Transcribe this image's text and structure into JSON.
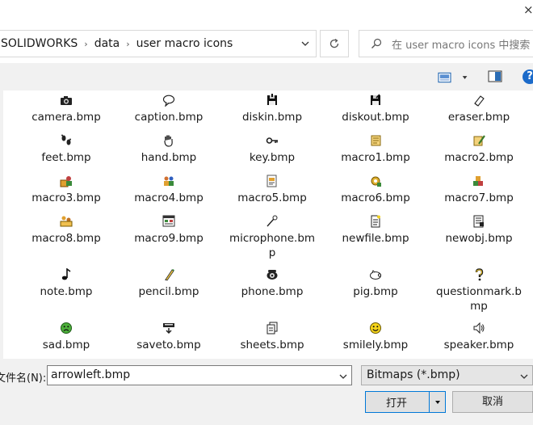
{
  "window": {
    "close_glyph": "×"
  },
  "address": {
    "crumbs": [
      "SOLIDWORKS",
      "data",
      "user macro icons"
    ],
    "separator": "›"
  },
  "search": {
    "placeholder": "在 user macro icons 中搜索"
  },
  "files": [
    {
      "name": "camera.bmp",
      "icon": "camera-icon"
    },
    {
      "name": "caption.bmp",
      "icon": "speech-bubble-icon"
    },
    {
      "name": "diskin.bmp",
      "icon": "floppy-disk-in-icon"
    },
    {
      "name": "diskout.bmp",
      "icon": "floppy-disk-out-icon"
    },
    {
      "name": "eraser.bmp",
      "icon": "eraser-icon"
    },
    {
      "name": "feet.bmp",
      "icon": "footprints-icon"
    },
    {
      "name": "hand.bmp",
      "icon": "hand-icon"
    },
    {
      "name": "key.bmp",
      "icon": "key-icon"
    },
    {
      "name": "macro1.bmp",
      "icon": "macro-scroll-icon"
    },
    {
      "name": "macro2.bmp",
      "icon": "macro-pencil-icon"
    },
    {
      "name": "macro3.bmp",
      "icon": "macro-user-icon"
    },
    {
      "name": "macro4.bmp",
      "icon": "macro-users-icon"
    },
    {
      "name": "macro5.bmp",
      "icon": "macro-document-icon"
    },
    {
      "name": "macro6.bmp",
      "icon": "macro-gear-icon"
    },
    {
      "name": "macro7.bmp",
      "icon": "macro-blocks-icon"
    },
    {
      "name": "macro8.bmp",
      "icon": "macro-people-icon"
    },
    {
      "name": "macro9.bmp",
      "icon": "macro-window-icon"
    },
    {
      "name": "microphone.bmp",
      "icon": "microphone-icon"
    },
    {
      "name": "newfile.bmp",
      "icon": "new-file-icon"
    },
    {
      "name": "newobj.bmp",
      "icon": "new-object-icon"
    },
    {
      "name": "note.bmp",
      "icon": "music-note-icon"
    },
    {
      "name": "pencil.bmp",
      "icon": "pencil-icon"
    },
    {
      "name": "phone.bmp",
      "icon": "phone-icon"
    },
    {
      "name": "pig.bmp",
      "icon": "pig-icon"
    },
    {
      "name": "questionmark.bmp",
      "icon": "question-mark-icon"
    },
    {
      "name": "sad.bmp",
      "icon": "sad-face-icon"
    },
    {
      "name": "saveto.bmp",
      "icon": "save-to-icon"
    },
    {
      "name": "sheets.bmp",
      "icon": "sheets-icon"
    },
    {
      "name": "smilely.bmp",
      "icon": "smiley-face-icon"
    },
    {
      "name": "speaker.bmp",
      "icon": "speaker-icon"
    }
  ],
  "bottom": {
    "filename_label": "文件名(N):",
    "filename_value": "arrowleft.bmp",
    "filetype_value": "Bitmaps (*.bmp)",
    "open_label": "打开",
    "cancel_label": "取消"
  },
  "colors": {
    "accent": "#0078d7",
    "help": "#1b6ac9",
    "toolbar_bg": "#f1f1f1"
  }
}
